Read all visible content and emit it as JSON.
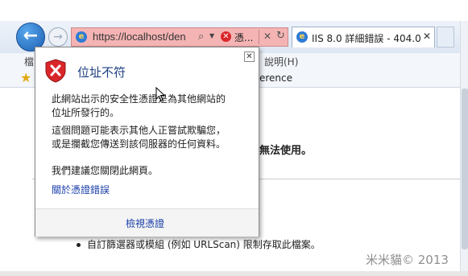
{
  "browser": {
    "address_url": "https://localhost/den",
    "cert_error_label": "憑...",
    "tab_title": "IIS 8.0 詳細錯誤 - 404.0 - ...",
    "menu_left": "檔",
    "menu_help": "說明(H)",
    "favorites_item": "erence"
  },
  "popup": {
    "title": "位址不符",
    "message1_line1": "此網站出示的安全性憑證是為其他網站的",
    "message1_line2": "位址所發行的。",
    "message2_line1": "這個問題可能表示其他人正嘗試欺騙您，",
    "message2_line2": "或是攔截您傳送到該伺服器的任何資料。",
    "recommend": "我們建議您關閉此網頁。",
    "about_link": "關於憑證錯誤",
    "view_cert": "檢視憑證"
  },
  "page": {
    "frag_bold": "無法使用。",
    "bullet_text": "自訂篩選器或模組 (例如 URLScan) 限制存取此檔案。"
  },
  "watermark": "米米貓© 2013",
  "colors": {
    "address_error_bg": "#f5b4b4",
    "back_button": "#1c5fb2",
    "popup_title": "#1e3f82",
    "shield_red": "#d9262a"
  }
}
